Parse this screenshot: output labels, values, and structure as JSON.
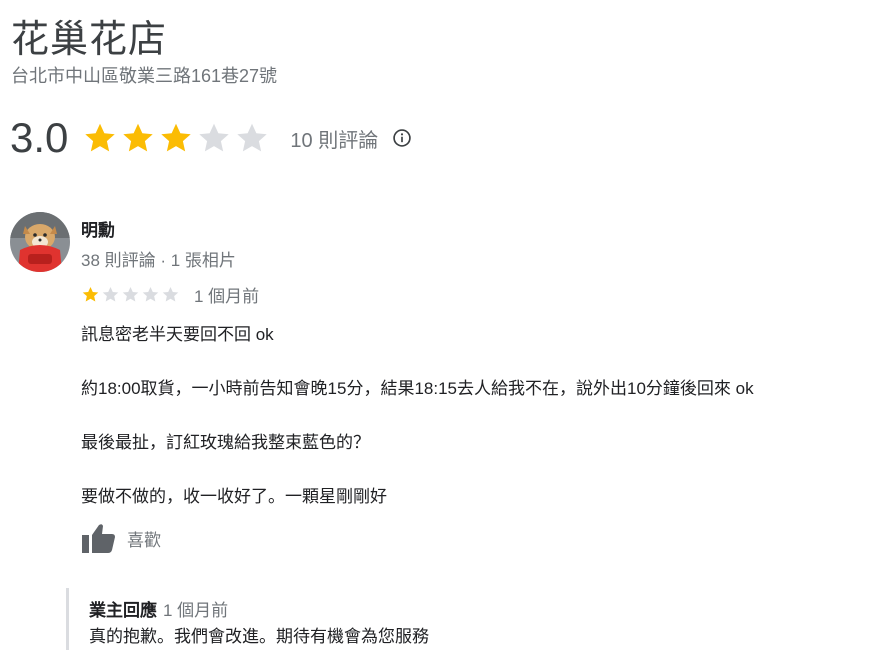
{
  "store": {
    "name": "花巢花店",
    "address": "台北市中山區敬業三路161巷27號"
  },
  "rating": {
    "value": "3.0",
    "stars": 3,
    "max_stars": 5,
    "review_count": "10 則評論",
    "info_icon": "info-icon"
  },
  "review": {
    "reviewer_name": "明勳",
    "reviewer_meta": "38 則評論 · 1 張相片",
    "stars": 1,
    "max_stars": 5,
    "time": "1 個月前",
    "paragraphs": [
      "訊息密老半天要回不回  ok",
      "約18:00取貨，一小時前告知會晚15分，結果18:15去人給我不在，說外出10分鐘後回來 ok",
      "最後最扯，訂紅玫瑰給我整束藍色的？",
      "要做不做的，收一收好了。一顆星剛剛好"
    ],
    "like_label": "喜歡",
    "like_icon": "thumbs-up-icon"
  },
  "owner_reply": {
    "title": "業主回應",
    "time": "1 個月前",
    "text": "真的抱歉。我們會改進。期待有機會為您服務"
  },
  "colors": {
    "star_filled": "#fbbc04",
    "star_empty": "#dadce0",
    "secondary_text": "#70757a"
  }
}
